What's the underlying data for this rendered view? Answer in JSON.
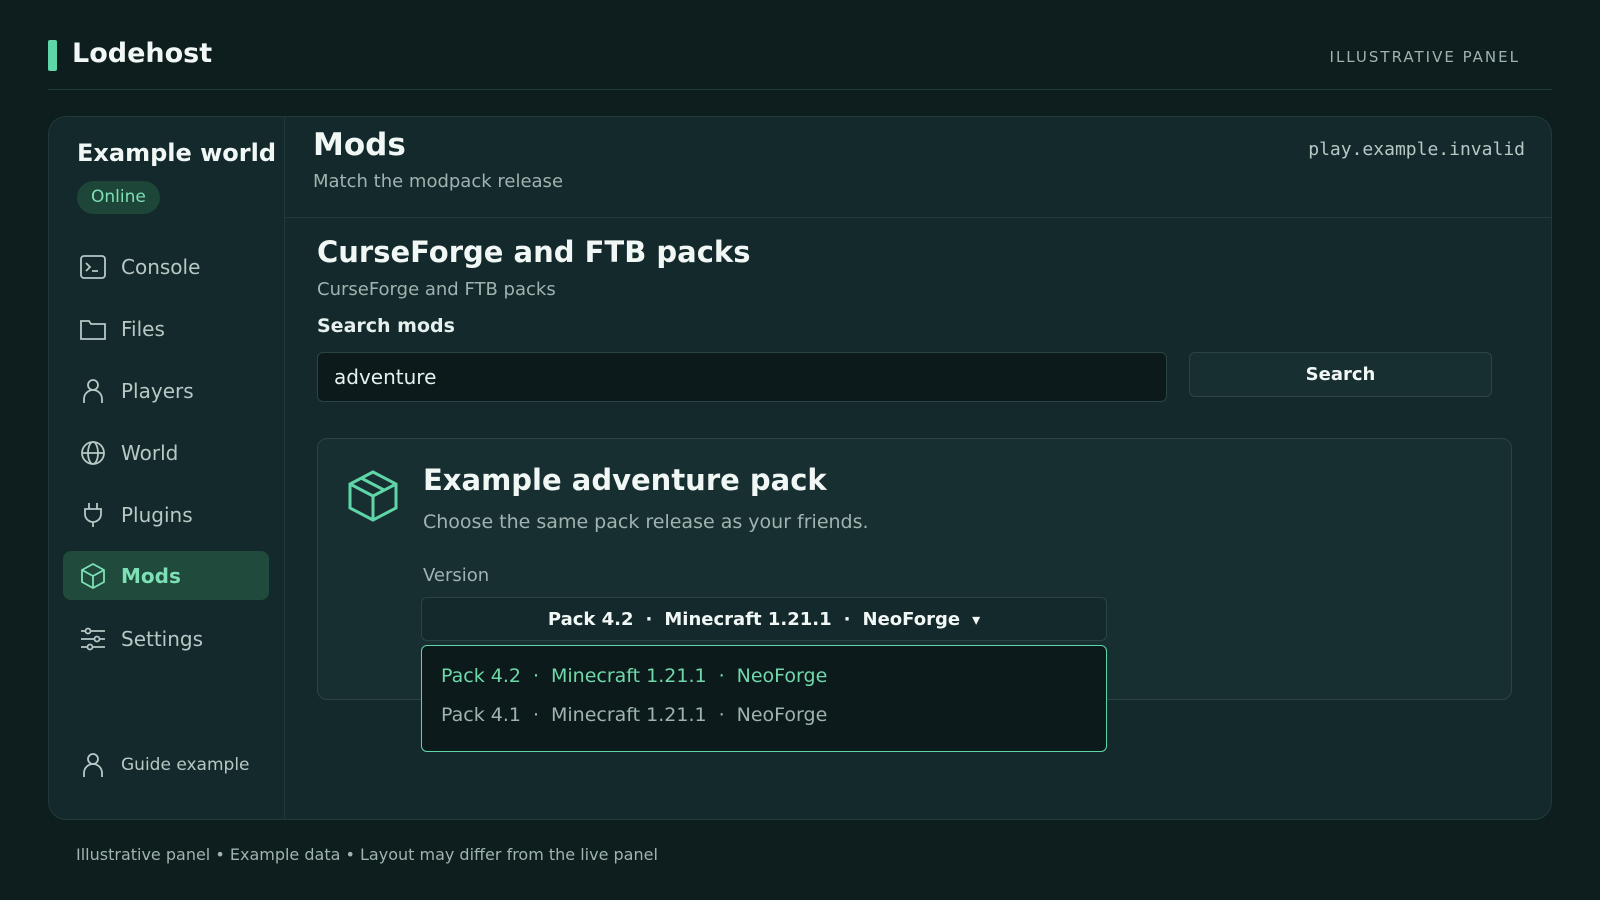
{
  "app": {
    "brand": "Lodehost",
    "top_right_label": "ILLUSTRATIVE PANEL"
  },
  "sidebar": {
    "world_name": "Example world",
    "status": "Online",
    "items": [
      {
        "label": "Console",
        "icon": "terminal-icon"
      },
      {
        "label": "Files",
        "icon": "folder-icon"
      },
      {
        "label": "Players",
        "icon": "user-icon"
      },
      {
        "label": "World",
        "icon": "globe-icon"
      },
      {
        "label": "Plugins",
        "icon": "plug-icon"
      },
      {
        "label": "Mods",
        "icon": "cube-icon",
        "active": true
      },
      {
        "label": "Settings",
        "icon": "sliders-icon"
      }
    ],
    "user_label": "Guide example"
  },
  "header": {
    "title": "Mods",
    "subtitle": "Match the modpack release",
    "server_address": "play.example.invalid"
  },
  "section": {
    "title": "CurseForge and FTB packs",
    "subtitle": "CurseForge and FTB packs"
  },
  "search": {
    "label": "Search mods",
    "value": "adventure",
    "button_label": "Search"
  },
  "pack": {
    "title": "Example adventure pack",
    "description": "Choose the same pack release as your friends.",
    "version_label": "Version",
    "selected_version": {
      "pack": "Pack 4.2",
      "minecraft": "Minecraft 1.21.1",
      "loader": "NeoForge",
      "caret": "▾"
    },
    "options": [
      {
        "pack": "Pack 4.2",
        "minecraft": "Minecraft 1.21.1",
        "loader": "NeoForge",
        "selected": true
      },
      {
        "pack": "Pack 4.1",
        "minecraft": "Minecraft 1.21.1",
        "loader": "NeoForge",
        "selected": false
      }
    ],
    "separator": "·"
  },
  "footer": {
    "note": "Illustrative panel • Example data • Layout may differ from the live panel"
  },
  "colors": {
    "accent": "#5fd6a8",
    "background": "#0e1d1e",
    "panel": "#14292b"
  }
}
